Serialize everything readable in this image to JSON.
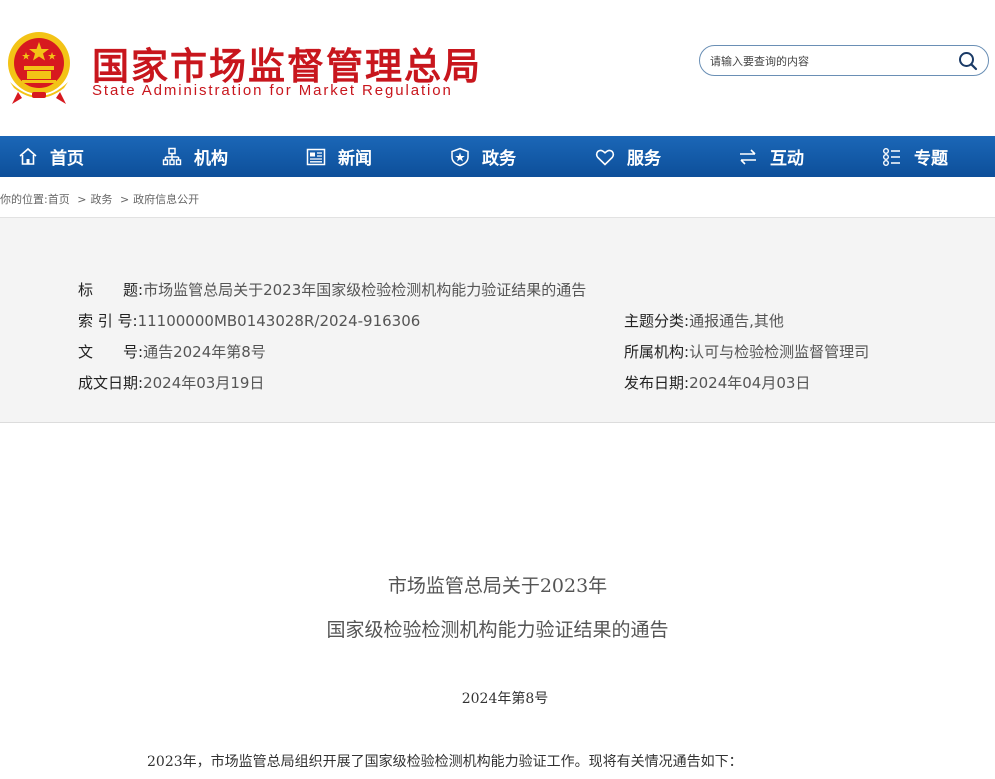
{
  "header": {
    "site_title": "国家市场监督管理总局",
    "site_subtitle": "State Administration for Market Regulation",
    "search_placeholder": "请输入要查询的内容"
  },
  "nav": {
    "items": [
      {
        "label": "首页",
        "icon": "home-icon"
      },
      {
        "label": "机构",
        "icon": "org-chart-icon"
      },
      {
        "label": "新闻",
        "icon": "news-icon"
      },
      {
        "label": "政务",
        "icon": "government-icon"
      },
      {
        "label": "服务",
        "icon": "heart-icon"
      },
      {
        "label": "互动",
        "icon": "exchange-icon"
      },
      {
        "label": "专题",
        "icon": "topics-icon"
      }
    ]
  },
  "breadcrumb": {
    "prefix": "你的位置:",
    "items": [
      "首页",
      "政务",
      "政府信息公开"
    ],
    "separator": ">"
  },
  "meta": {
    "title_label": "标　　题:",
    "title_value": "市场监管总局关于2023年国家级检验检测机构能力验证结果的通告",
    "index_label": "索 引 号:",
    "index_value": "11100000MB0143028R/2024-916306",
    "doc_label": "文　　号:",
    "doc_value": "通告2024年第8号",
    "created_label": "成文日期:",
    "created_value": "2024年03月19日",
    "topic_label": "主题分类:",
    "topic_value": "通报通告,其他",
    "org_label": "所属机构:",
    "org_value": "认可与检验检测监督管理司",
    "published_label": "发布日期:",
    "published_value": "2024年04月03日"
  },
  "document": {
    "title_line1": "市场监管总局关于2023年",
    "title_line2": "国家级检验检测机构能力验证结果的通告",
    "number": "2024年第8号",
    "first_paragraph": "2023年，市场监管总局组织开展了国家级检验检测机构能力验证工作。现将有关情况通告如下："
  },
  "colors": {
    "brand_red": "#c8161d",
    "nav_blue": "#1b67b7",
    "meta_background": "#f4f4f4"
  }
}
